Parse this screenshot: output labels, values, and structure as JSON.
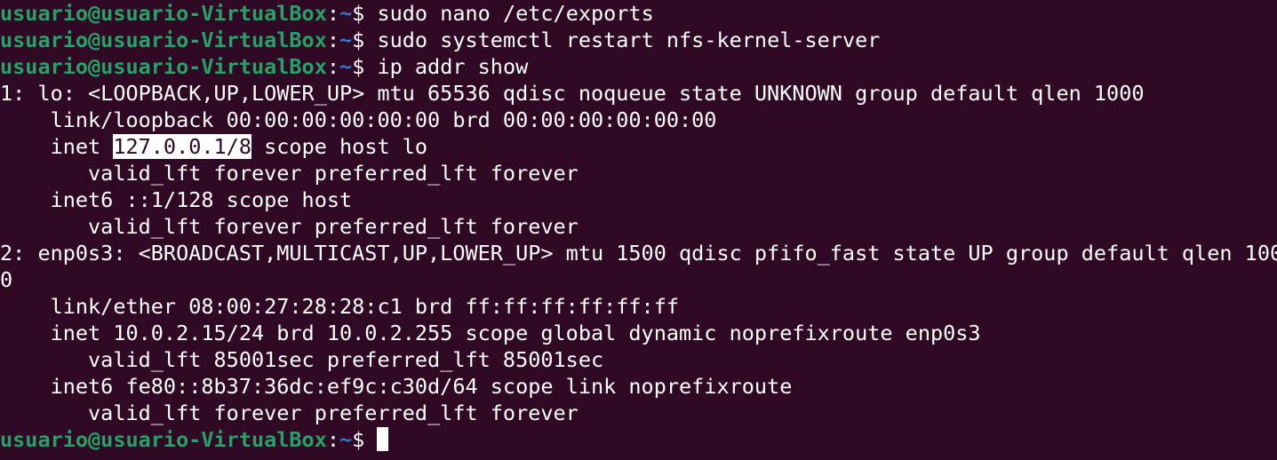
{
  "prompt": {
    "user_host": "usuario@usuario-VirtualBox",
    "colon": ":",
    "path": "~",
    "symbol": "$ "
  },
  "commands": [
    "sudo nano /etc/exports",
    "sudo systemctl restart nfs-kernel-server",
    "ip addr show"
  ],
  "output": [
    "1: lo: <LOOPBACK,UP,LOWER_UP> mtu 65536 qdisc noqueue state UNKNOWN group default qlen 1000",
    "    link/loopback 00:00:00:00:00:00 brd 00:00:00:00:00:00",
    {
      "prefix": "    inet ",
      "highlight": "127.0.0.1/8",
      "suffix": " scope host lo"
    },
    "       valid_lft forever preferred_lft forever",
    "    inet6 ::1/128 scope host",
    "       valid_lft forever preferred_lft forever",
    "2: enp0s3: <BROADCAST,MULTICAST,UP,LOWER_UP> mtu 1500 qdisc pfifo_fast state UP group default qlen 100",
    "0",
    "    link/ether 08:00:27:28:28:c1 brd ff:ff:ff:ff:ff:ff",
    "    inet 10.0.2.15/24 brd 10.0.2.255 scope global dynamic noprefixroute enp0s3",
    "       valid_lft 85001sec preferred_lft 85001sec",
    "    inet6 fe80::8b37:36dc:ef9c:c30d/64 scope link noprefixroute",
    "       valid_lft forever preferred_lft forever"
  ],
  "colors": {
    "background": "#300a24",
    "prompt_user": "#26a269",
    "prompt_path": "#2a7bde",
    "text": "#ffffff"
  }
}
